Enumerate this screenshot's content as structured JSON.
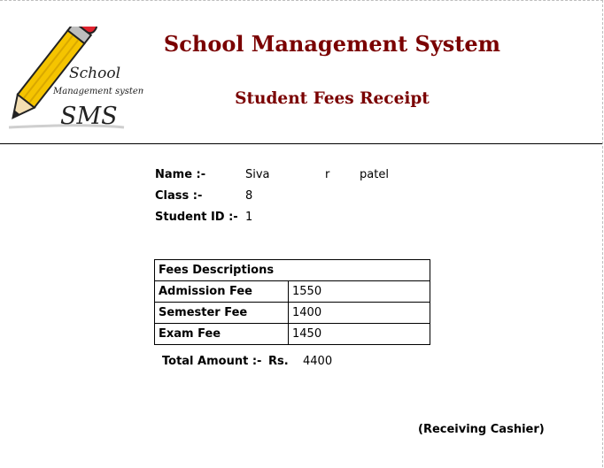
{
  "header": {
    "logo": {
      "line1": "School",
      "line2": "Management system",
      "line3": "SMS",
      "icon": "pencil-icon",
      "colors": {
        "pencil": "#f5c400",
        "eraser": "#e0222e",
        "text": "#222222"
      }
    },
    "title": "School Management System",
    "subtitle": "Student Fees Receipt",
    "title_color": "#7a0000"
  },
  "student": {
    "name_label": "Name :-",
    "first_name": "Siva",
    "middle_name": "r",
    "last_name": "patel",
    "class_label": "Class :-",
    "class_value": "8",
    "id_label": "Student ID :-",
    "id_value": "1"
  },
  "fees": {
    "heading": "Fees Descriptions",
    "rows": [
      {
        "label": "Admission Fee",
        "amount": "1550"
      },
      {
        "label": "Semester Fee",
        "amount": "1400"
      },
      {
        "label": "Exam Fee",
        "amount": "1450"
      }
    ]
  },
  "total": {
    "label": "Total Amount :-",
    "currency": "Rs.",
    "value": "4400"
  },
  "signature": {
    "cashier_label": "(Receiving Cashier)"
  }
}
